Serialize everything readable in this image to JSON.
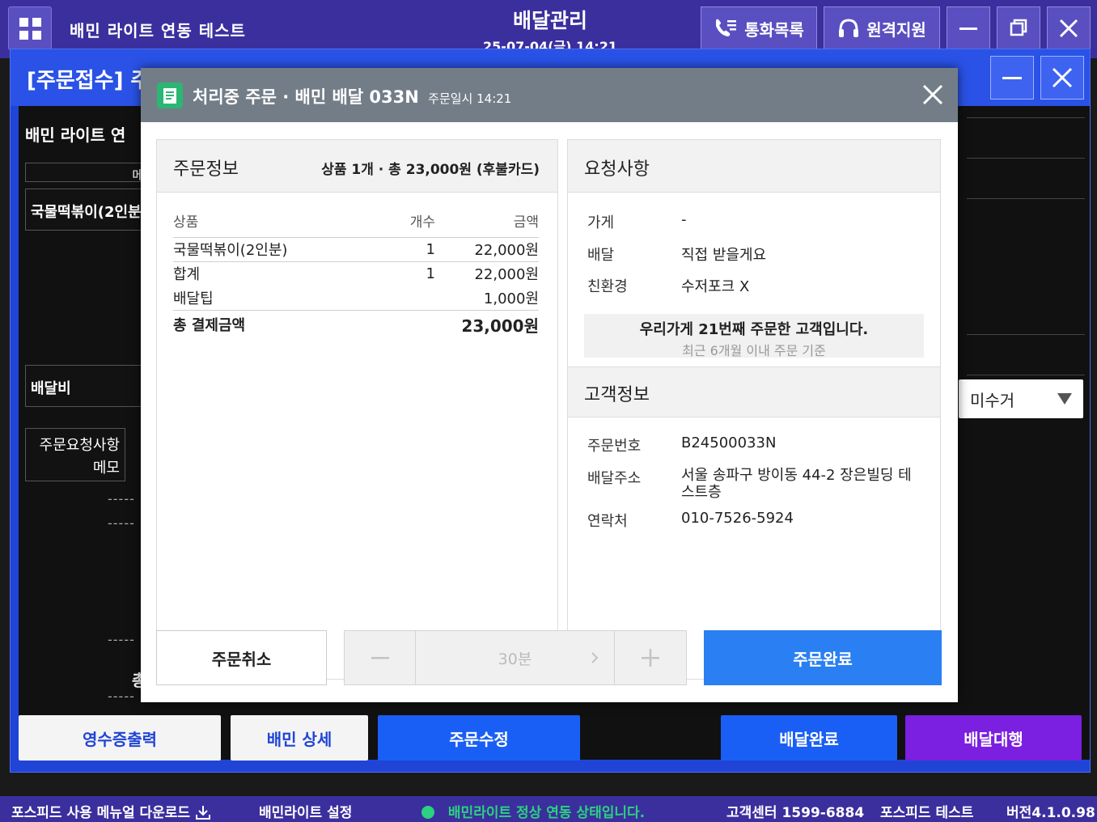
{
  "app": {
    "title": "배민 라이트 연동 테스트",
    "center_title": "배달관리",
    "date": "25-07-04(금) 14:21",
    "call_log_label": "통화목록",
    "remote_support_label": "원격지원"
  },
  "background_window": {
    "title": "[주문접수] 주",
    "store_name": "배민 라이트 연",
    "col_header": "메",
    "item_name": "국물떡볶이(2인분",
    "delivery_fee_label": "배달비",
    "request_memo_label_1": "주문요청사항",
    "request_memo_label_2": "메모",
    "dashes": "-----",
    "total_fragment": "총",
    "payment_status": "미수거",
    "buttons": {
      "receipt": "영수증출력",
      "baemin_detail": "배민 상세",
      "edit_order": "주문수정",
      "delivery_done": "배달완료",
      "delivery_agent": "배달대행"
    }
  },
  "dialog": {
    "title": "처리중 주문 · 배민 배달 033N",
    "order_time": "주문일시 14:21",
    "order_info": {
      "heading": "주문정보",
      "summary": "상품 1개 · 총 23,000원 (후불카드)",
      "columns": [
        "상품",
        "개수",
        "금액"
      ],
      "items": [
        {
          "name": "국물떡볶이(2인분)",
          "qty": "1",
          "amount": "22,000원"
        }
      ],
      "subtotal": {
        "label": "합계",
        "qty": "1",
        "amount": "22,000원"
      },
      "tip": {
        "label": "배달팁",
        "amount": "1,000원"
      },
      "total": {
        "label": "총 결제금액",
        "amount": "23,000원"
      }
    },
    "requests": {
      "heading": "요청사항",
      "rows": [
        {
          "k": "가게",
          "v": "-"
        },
        {
          "k": "배달",
          "v": "직접 받을게요"
        },
        {
          "k": "친환경",
          "v": "수저포크 X"
        }
      ],
      "notice_main": "우리가게 21번째 주문한 고객입니다.",
      "notice_sub": "최근 6개월 이내 주문 기준"
    },
    "customer": {
      "heading": "고객정보",
      "order_no_label": "주문번호",
      "order_no": "B24500033N",
      "address_label": "배달주소",
      "address_1": "서울 송파구 방이동 44-2 장은빌딩 테",
      "address_2": "스트층",
      "phone_label": "연락처",
      "phone": "010-7526-5924"
    },
    "actions": {
      "cancel": "주문취소",
      "time": "30분",
      "complete": "주문완료"
    }
  },
  "status_bar": {
    "manual": "포스피드 사용 메뉴얼 다운로드",
    "settings": "배민라이트 설정",
    "status": "배민라이트 정상 연동 상태입니다.",
    "support": "고객센터 1599-6884",
    "store": "포스피드 테스트",
    "version": "버전4.1.0.98"
  },
  "colors": {
    "appbar": "#3b2f9e",
    "window": "#1f44d6",
    "primary_blue": "#2a7ff2",
    "purple": "#7b1fe0",
    "status_green": "#2bd27f"
  }
}
